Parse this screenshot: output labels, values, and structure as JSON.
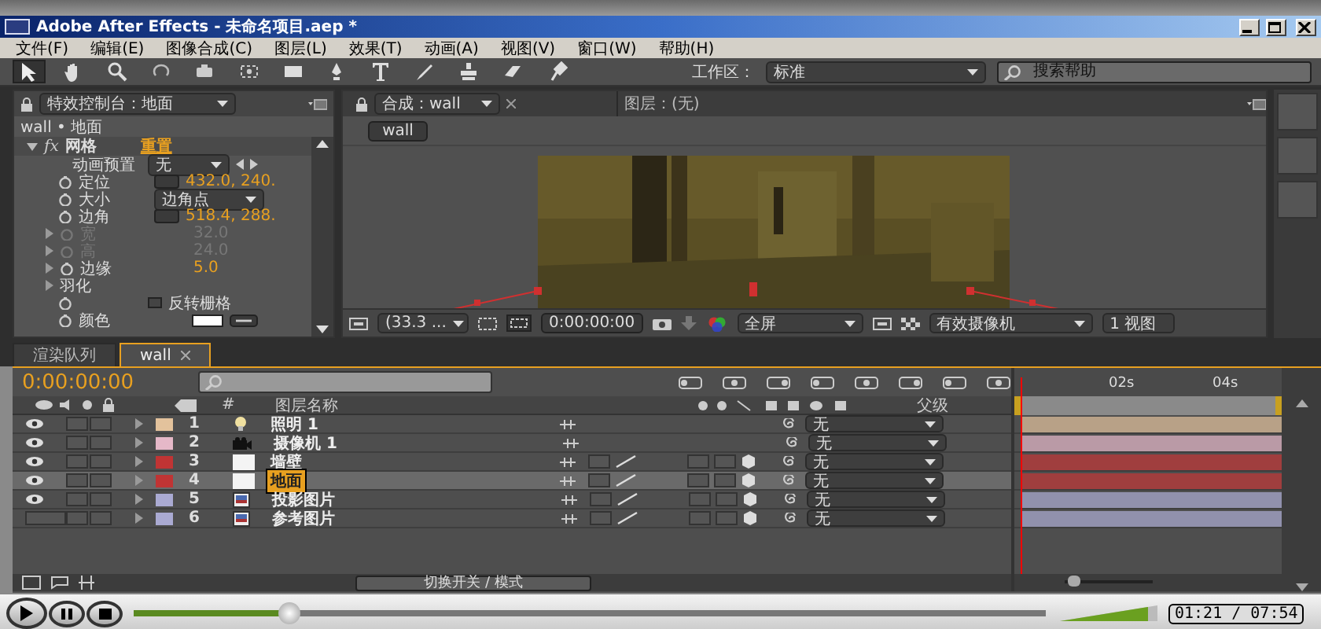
{
  "title_bar": {
    "title": "Adobe After Effects - 未命名项目.aep *"
  },
  "menu": [
    "文件(F)",
    "编辑(E)",
    "图像合成(C)",
    "图层(L)",
    "效果(T)",
    "动画(A)",
    "视图(V)",
    "窗口(W)",
    "帮助(H)"
  ],
  "toolbar": {
    "workspace_label": "工作区：",
    "workspace": "标准",
    "search": {
      "placeholder": "搜索帮助"
    }
  },
  "effects_panel": {
    "tab": "特效控制台：地面",
    "layer_path": "wall • 地面",
    "effect": {
      "badge": "fx",
      "name": "网格",
      "reset": "重置"
    },
    "properties": [
      {
        "kind": "dropdown",
        "label": "动画预置",
        "value": "无",
        "disabled": false
      },
      {
        "kind": "point",
        "label": "定位",
        "value": "432.0, 240.",
        "disabled": false
      },
      {
        "kind": "dropdown",
        "label": "大小",
        "value": "边角点",
        "disabled": false
      },
      {
        "kind": "point",
        "label": "边角",
        "value": "518.4, 288.",
        "disabled": false
      },
      {
        "kind": "number",
        "label": "宽",
        "value": "32.0",
        "disabled": true
      },
      {
        "kind": "number",
        "label": "高",
        "value": "24.0",
        "disabled": true
      },
      {
        "kind": "number",
        "label": "边缘",
        "value": "5.0",
        "disabled": false
      },
      {
        "kind": "group",
        "label": "羽化",
        "disabled": false
      },
      {
        "kind": "checkbox",
        "label": "反转栅格",
        "checked": false,
        "disabled": false
      },
      {
        "kind": "color",
        "label": "颜色",
        "disabled": false
      }
    ]
  },
  "comp_panel": {
    "tab": "合成：wall",
    "layer_tab": "图层：(无)",
    "comp_button": "wall",
    "controls": {
      "zoom": "(33.3 ...",
      "time": "0:00:00:00",
      "resolution": "全屏",
      "camera": "有效摄像机",
      "views": "1 视图"
    }
  },
  "tabs": [
    {
      "label": "渲染队列",
      "selected": false
    },
    {
      "label": "wall",
      "selected": true
    }
  ],
  "timeline": {
    "time": "0:00:00:00",
    "columns": {
      "number": "#",
      "name": "图层名称",
      "parent": "父级"
    },
    "ruler": [
      "02s",
      "04s"
    ],
    "layers": [
      {
        "number": "1",
        "name": "照明 1",
        "kind": "light",
        "color": "#e3c29c",
        "visible": true,
        "selected": false,
        "parent": "无"
      },
      {
        "number": "2",
        "name": "摄像机 1",
        "kind": "camera",
        "color": "#e5b8c8",
        "visible": true,
        "selected": false,
        "parent": "无"
      },
      {
        "number": "3",
        "name": "墙壁",
        "kind": "solid",
        "color": "#c03434",
        "visible": true,
        "selected": false,
        "parent": "无"
      },
      {
        "number": "4",
        "name": "地面",
        "kind": "solid",
        "color": "#c03434",
        "visible": true,
        "selected": true,
        "parent": "无"
      },
      {
        "number": "5",
        "name": "投影图片",
        "kind": "footage",
        "color": "#aaaad2",
        "visible": true,
        "selected": false,
        "parent": "无"
      },
      {
        "number": "6",
        "name": "参考图片",
        "kind": "footage",
        "color": "#aaaad2",
        "visible": false,
        "selected": false,
        "parent": "无"
      }
    ],
    "switch_button": "切换开关 / 模式"
  },
  "player": {
    "position": {
      "level": 0.17
    },
    "volume": {
      "level": 0.9
    },
    "time": "01:21 / 07:54"
  }
}
